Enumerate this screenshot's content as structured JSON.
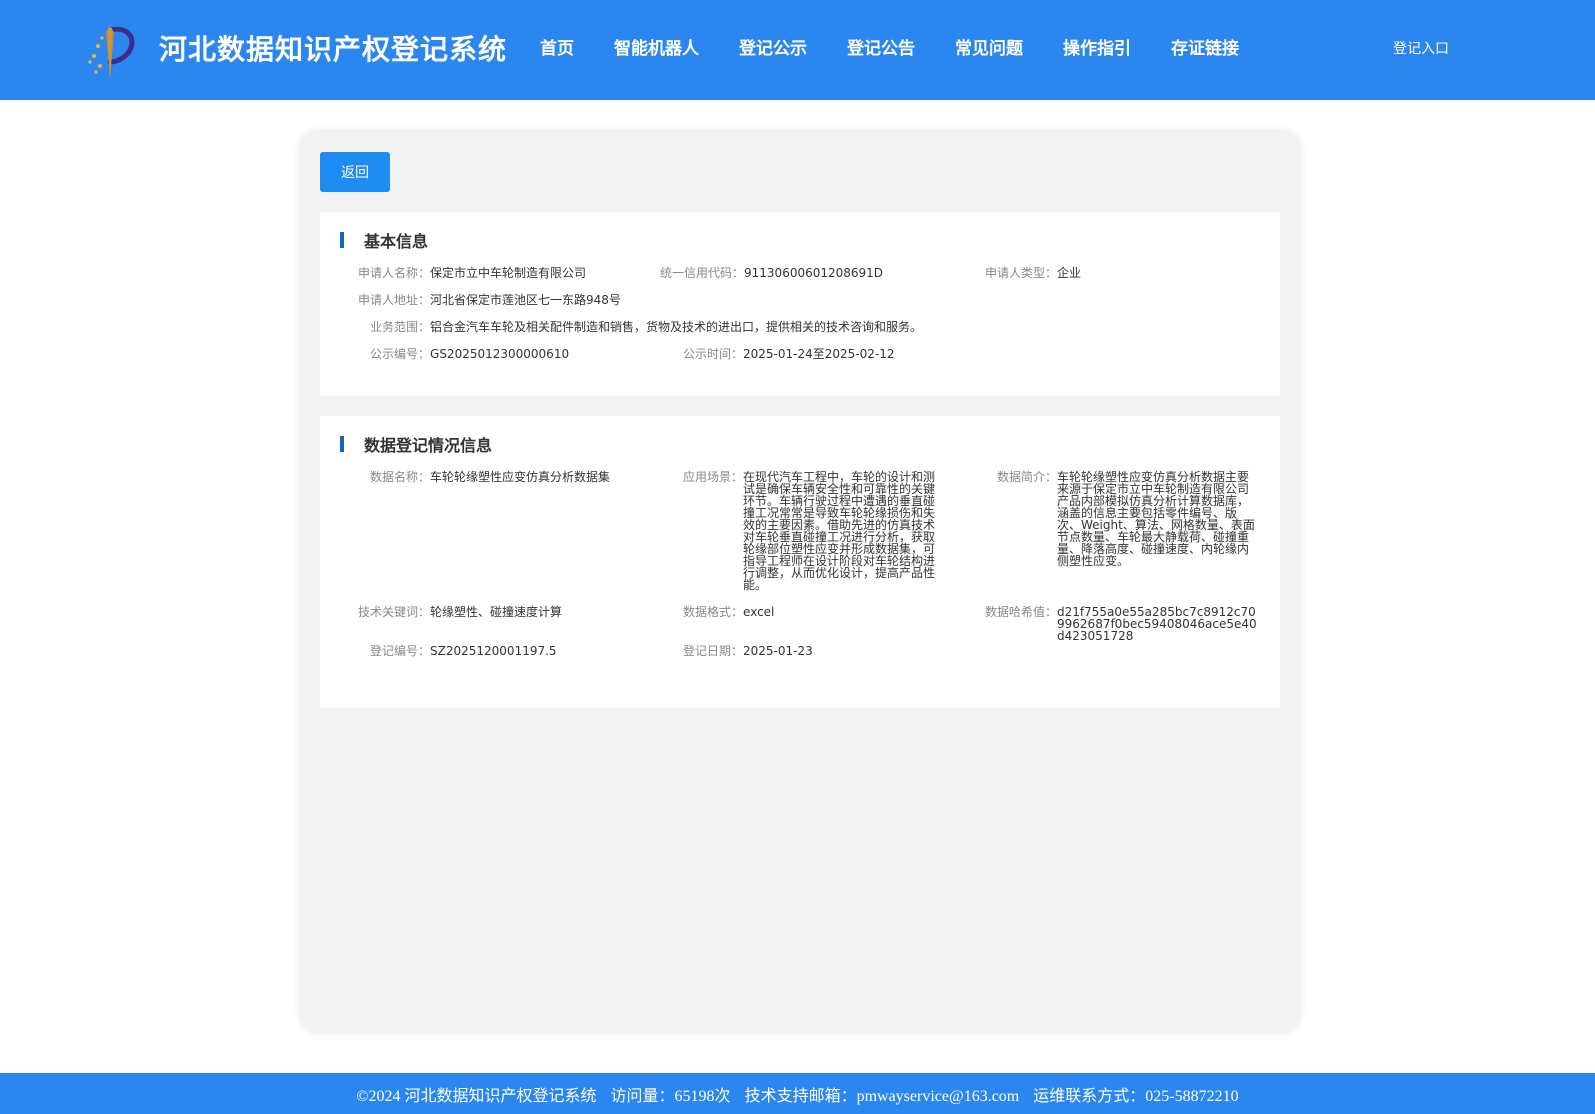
{
  "header": {
    "site_title": "河北数据知识产权登记系统",
    "logo_icon": "brush-star-logo-icon",
    "nav": [
      "首页",
      "智能机器人",
      "登记公示",
      "登记公告",
      "常见问题",
      "操作指引",
      "存证链接"
    ],
    "login": "登记入口"
  },
  "back_button": "返回",
  "basic": {
    "title": "基本信息",
    "applicant_name": {
      "label": "申请人名称：",
      "value": "保定市立中车轮制造有限公司"
    },
    "credit_code": {
      "label": "统一信用代码：",
      "value": "91130600601208691D"
    },
    "applicant_type": {
      "label": "申请人类型：",
      "value": "企业"
    },
    "address": {
      "label": "申请人地址：",
      "value": "河北省保定市莲池区七一东路948号"
    },
    "scope": {
      "label": "业务范围：",
      "value": "铝合金汽车车轮及相关配件制造和销售，货物及技术的进出口，提供相关的技术咨询和服务。"
    },
    "publicity_no": {
      "label": "公示编号：",
      "value": "GS2025012300000610"
    },
    "publicity_time": {
      "label": "公示时间：",
      "value": "2025-01-24至2025-02-12"
    }
  },
  "registration": {
    "title": "数据登记情况信息",
    "data_name": {
      "label": "数据名称：",
      "value": "车轮轮缘塑性应变仿真分析数据集"
    },
    "scenario": {
      "label": "应用场景：",
      "value": "在现代汽车工程中，车轮的设计和测试是确保车辆安全性和可靠性的关键环节。车辆行驶过程中遭遇的垂直碰撞工况常常是导致车轮轮缘损伤和失效的主要因素。借助先进的仿真技术对车轮垂直碰撞工况进行分析，获取轮缘部位塑性应变并形成数据集，可指导工程师在设计阶段对车轮结构进行调整，从而优化设计，提高产品性能。"
    },
    "intro": {
      "label": "数据简介：",
      "value": "车轮轮缘塑性应变仿真分析数据主要来源于保定市立中车轮制造有限公司产品内部模拟仿真分析计算数据库，涵盖的信息主要包括零件编号、版次、Weight、算法、网格数量、表面节点数量、车轮最大静载荷、碰撞重量、降落高度、碰撞速度、内轮缘内侧塑性应变。"
    },
    "keywords": {
      "label": "技术关键词：",
      "value": "轮缘塑性、碰撞速度计算"
    },
    "format": {
      "label": "数据格式：",
      "value": "excel"
    },
    "hash": {
      "label": "数据哈希值：",
      "value": "d21f755a0e55a285bc7c8912c709962687f0bec59408046ace5e40d423051728"
    },
    "reg_no": {
      "label": "登记编号：",
      "value": "SZ2025120001197.5"
    },
    "reg_date": {
      "label": "登记日期：",
      "value": "2025-01-23"
    }
  },
  "footer": {
    "copyright": "©2024 河北数据知识产权登记系统",
    "visits": "访问量：65198次",
    "email": "技术支持邮箱：pmwayservice@163.com",
    "phone": "运维联系方式：025-58872210"
  },
  "colors": {
    "primary": "#2b86f0",
    "button": "#1e8cf0",
    "title_bar": "#1565c0"
  }
}
